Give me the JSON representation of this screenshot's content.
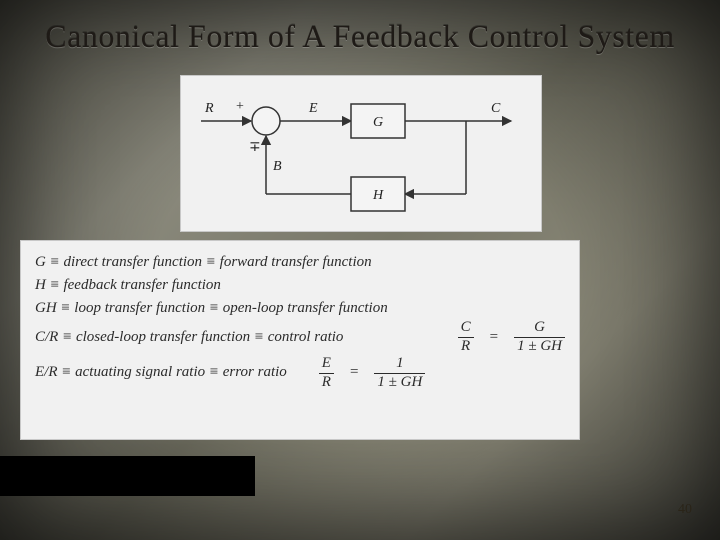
{
  "title": "Canonical Form of A Feedback Control System",
  "page_number": "40",
  "diagram": {
    "input_label": "R",
    "sum_plus": "+",
    "sum_minus": "∓",
    "error_label": "E",
    "forward_block": "G",
    "output_label": "C",
    "feedback_label": "B",
    "feedback_block": "H"
  },
  "definitions": {
    "g": "G ≡ direct transfer function ≡ forward transfer function",
    "h": "H ≡ feedback transfer function",
    "gh": "GH ≡ loop transfer function ≡ open-loop transfer function",
    "cr_text": "C/R ≡ closed-loop transfer function ≡ control ratio",
    "er_text": "E/R ≡ actuating signal ratio ≡ error ratio",
    "eq1_lhs_num": "C",
    "eq1_lhs_den": "R",
    "eq1_rhs_num": "G",
    "eq1_rhs_den": "1 ± GH",
    "eq2_lhs_num": "E",
    "eq2_lhs_den": "R",
    "eq2_rhs_num": "1",
    "eq2_rhs_den": "1 ± GH",
    "equals": "="
  }
}
